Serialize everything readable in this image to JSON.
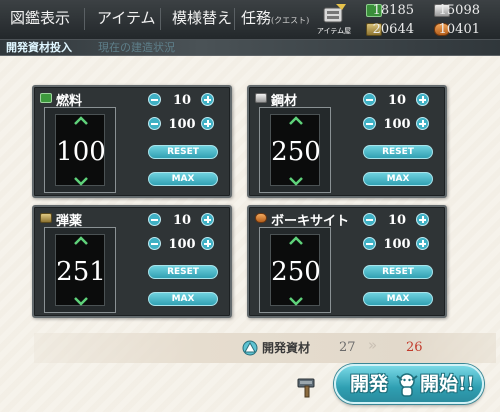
{
  "menu": {
    "items": [
      {
        "label": "図鑑表示"
      },
      {
        "label": "アイテム"
      },
      {
        "label": "模様替え"
      },
      {
        "label": "任務",
        "sub": "(クエスト)"
      }
    ],
    "item_list_label": "アイテム屋"
  },
  "resources": {
    "fuel": "18185",
    "steel": "15098",
    "ammo": "20644",
    "bauxite": "10401"
  },
  "section": {
    "title": "開発資材投入",
    "ghost": "現在の建造状況"
  },
  "cards": [
    {
      "name": "燃料",
      "value": "100",
      "step_small": "10",
      "step_large": "100",
      "reset": "RESET",
      "max": "MAX",
      "color": "#3d9a3d"
    },
    {
      "name": "鋼材",
      "value": "250",
      "step_small": "10",
      "step_large": "100",
      "reset": "RESET",
      "max": "MAX",
      "color": "#c7c7c7"
    },
    {
      "name": "弾薬",
      "value": "251",
      "step_small": "10",
      "step_large": "100",
      "reset": "RESET",
      "max": "MAX",
      "color": "#b99a4a"
    },
    {
      "name": "ボーキサイト",
      "value": "250",
      "step_small": "10",
      "step_large": "100",
      "reset": "RESET",
      "max": "MAX",
      "color": "#d07a2a"
    }
  ],
  "dev_material": {
    "label": "開発資材",
    "current": "27",
    "after": "26"
  },
  "start_button": {
    "left": "開発",
    "right": "開始!!"
  },
  "colors": {
    "accent": "#3fb0c4",
    "panel_bg": "#f6f2ea",
    "card_bg": "#2f3436",
    "after_value": "#c23b2c"
  }
}
